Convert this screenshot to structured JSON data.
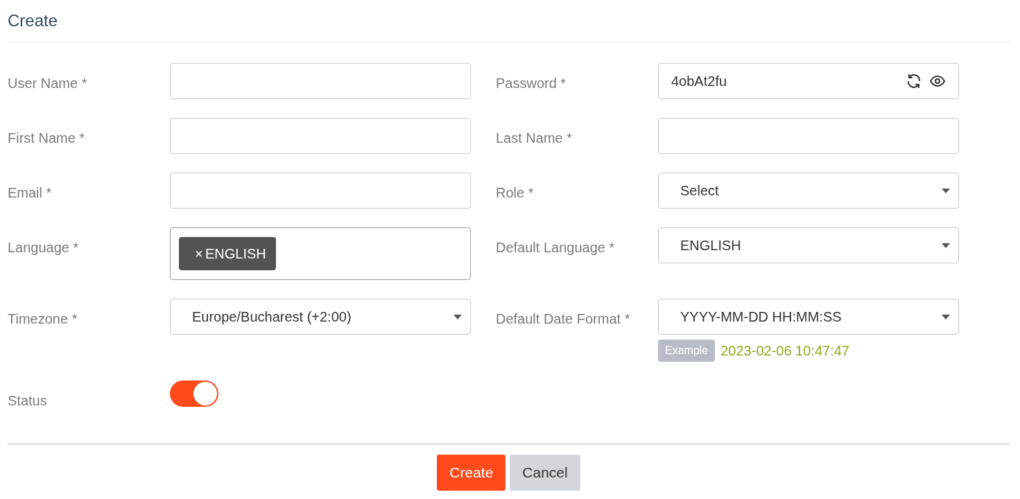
{
  "title": "Create",
  "fields": [
    {
      "label": "User Name *",
      "kind": "text"
    },
    {
      "label": "Password *",
      "kind": "password",
      "value": "4obAt2fu"
    },
    {
      "label": "First Name *",
      "kind": "text"
    },
    {
      "label": "Last Name *",
      "kind": "text"
    },
    {
      "label": "Email *",
      "kind": "text"
    },
    {
      "label": "Role *",
      "kind": "select",
      "value": "Select"
    },
    {
      "label": "Language *",
      "kind": "tags",
      "tags": [
        {
          "label": "ENGLISH",
          "remove": "×"
        }
      ]
    },
    {
      "label": "Default Language *",
      "kind": "select",
      "value": "ENGLISH"
    },
    {
      "label": "Timezone *",
      "kind": "select",
      "value": "Europe/Bucharest (+2:00)"
    },
    {
      "label": "Default Date Format *",
      "kind": "select",
      "value": "YYYY-MM-DD HH:MM:SS",
      "example": {
        "badge": "Example",
        "value": "2023-02-06 10:47:47"
      }
    },
    {
      "label": "Status",
      "kind": "toggle",
      "on": true
    }
  ],
  "buttons": [
    {
      "label": "Create",
      "kind": "primary"
    },
    {
      "label": "Cancel",
      "kind": "secondary"
    }
  ]
}
